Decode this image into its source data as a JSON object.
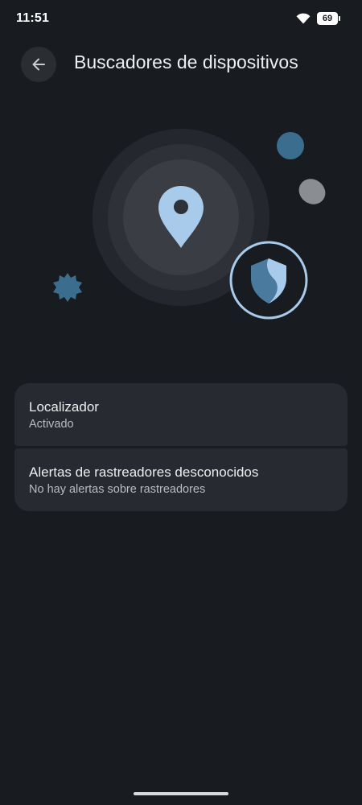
{
  "status_bar": {
    "time": "11:51",
    "wifi_icon": "wifi-icon",
    "battery_level": "69"
  },
  "app_bar": {
    "back_icon": "arrow-back-icon",
    "title": "Buscadores de dispositivos"
  },
  "illustration": {
    "icons": [
      "location-pin-icon",
      "shield-icon",
      "badge-star-icon"
    ],
    "colors": {
      "pin": "#a8cbec",
      "shield_ring": "#a8cbec",
      "dot_blue": "#3b6d8f",
      "dot_grey": "#8a8e93"
    }
  },
  "settings": {
    "items": [
      {
        "title": "Localizador",
        "subtitle": "Activado"
      },
      {
        "title": "Alertas de rastreadores desconocidos",
        "subtitle": "No hay alertas sobre rastreadores"
      }
    ]
  },
  "colors": {
    "background": "#181c20",
    "card": "#272b31",
    "text_primary": "#eceef0",
    "text_secondary": "#b8bcc2"
  }
}
